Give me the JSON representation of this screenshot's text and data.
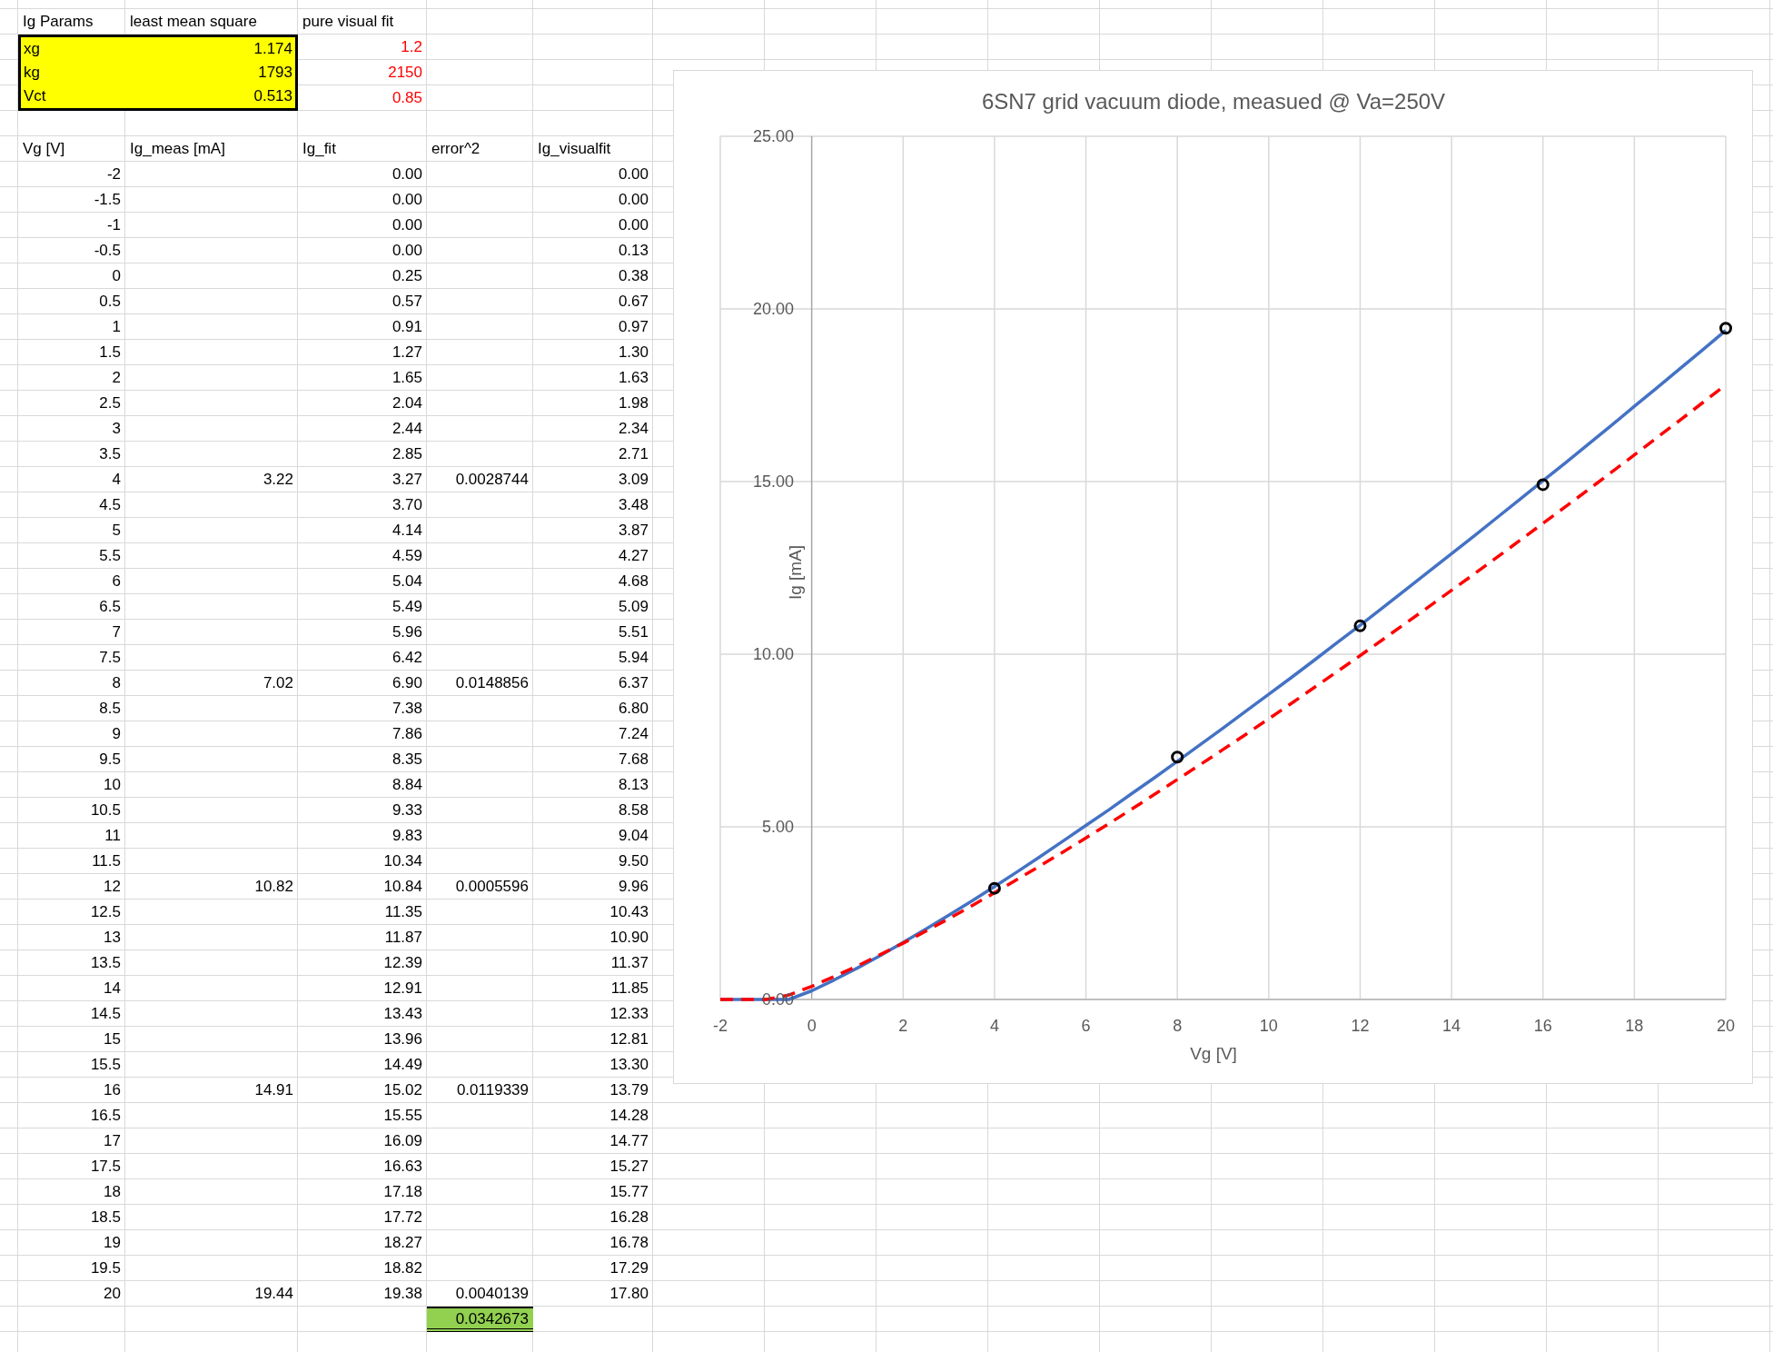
{
  "params": {
    "columns": [
      "Ig Params",
      "least mean square",
      "pure visual fit"
    ],
    "rows": [
      {
        "name": "xg",
        "least_mean_square": "1.174",
        "pure_visual_fit": "1.2"
      },
      {
        "name": "kg",
        "least_mean_square": "1793",
        "pure_visual_fit": "2150"
      },
      {
        "name": "Vct",
        "least_mean_square": "0.513",
        "pure_visual_fit": "0.85"
      }
    ]
  },
  "table": {
    "columns": [
      "Vg [V]",
      "Ig_meas [mA]",
      "Ig_fit",
      "error^2",
      "Ig_visualfit"
    ],
    "rows": [
      {
        "vg": "-2",
        "ig_fit": "0.00",
        "ig_visualfit": "0.00"
      },
      {
        "vg": "-1.5",
        "ig_fit": "0.00",
        "ig_visualfit": "0.00"
      },
      {
        "vg": "-1",
        "ig_fit": "0.00",
        "ig_visualfit": "0.00"
      },
      {
        "vg": "-0.5",
        "ig_fit": "0.00",
        "ig_visualfit": "0.13"
      },
      {
        "vg": "0",
        "ig_fit": "0.25",
        "ig_visualfit": "0.38"
      },
      {
        "vg": "0.5",
        "ig_fit": "0.57",
        "ig_visualfit": "0.67"
      },
      {
        "vg": "1",
        "ig_fit": "0.91",
        "ig_visualfit": "0.97"
      },
      {
        "vg": "1.5",
        "ig_fit": "1.27",
        "ig_visualfit": "1.30"
      },
      {
        "vg": "2",
        "ig_fit": "1.65",
        "ig_visualfit": "1.63"
      },
      {
        "vg": "2.5",
        "ig_fit": "2.04",
        "ig_visualfit": "1.98"
      },
      {
        "vg": "3",
        "ig_fit": "2.44",
        "ig_visualfit": "2.34"
      },
      {
        "vg": "3.5",
        "ig_fit": "2.85",
        "ig_visualfit": "2.71"
      },
      {
        "vg": "4",
        "ig_meas": "3.22",
        "ig_fit": "3.27",
        "error2": "0.0028744",
        "ig_visualfit": "3.09"
      },
      {
        "vg": "4.5",
        "ig_fit": "3.70",
        "ig_visualfit": "3.48"
      },
      {
        "vg": "5",
        "ig_fit": "4.14",
        "ig_visualfit": "3.87"
      },
      {
        "vg": "5.5",
        "ig_fit": "4.59",
        "ig_visualfit": "4.27"
      },
      {
        "vg": "6",
        "ig_fit": "5.04",
        "ig_visualfit": "4.68"
      },
      {
        "vg": "6.5",
        "ig_fit": "5.49",
        "ig_visualfit": "5.09"
      },
      {
        "vg": "7",
        "ig_fit": "5.96",
        "ig_visualfit": "5.51"
      },
      {
        "vg": "7.5",
        "ig_fit": "6.42",
        "ig_visualfit": "5.94"
      },
      {
        "vg": "8",
        "ig_meas": "7.02",
        "ig_fit": "6.90",
        "error2": "0.0148856",
        "ig_visualfit": "6.37"
      },
      {
        "vg": "8.5",
        "ig_fit": "7.38",
        "ig_visualfit": "6.80"
      },
      {
        "vg": "9",
        "ig_fit": "7.86",
        "ig_visualfit": "7.24"
      },
      {
        "vg": "9.5",
        "ig_fit": "8.35",
        "ig_visualfit": "7.68"
      },
      {
        "vg": "10",
        "ig_fit": "8.84",
        "ig_visualfit": "8.13"
      },
      {
        "vg": "10.5",
        "ig_fit": "9.33",
        "ig_visualfit": "8.58"
      },
      {
        "vg": "11",
        "ig_fit": "9.83",
        "ig_visualfit": "9.04"
      },
      {
        "vg": "11.5",
        "ig_fit": "10.34",
        "ig_visualfit": "9.50"
      },
      {
        "vg": "12",
        "ig_meas": "10.82",
        "ig_fit": "10.84",
        "error2": "0.0005596",
        "ig_visualfit": "9.96"
      },
      {
        "vg": "12.5",
        "ig_fit": "11.35",
        "ig_visualfit": "10.43"
      },
      {
        "vg": "13",
        "ig_fit": "11.87",
        "ig_visualfit": "10.90"
      },
      {
        "vg": "13.5",
        "ig_fit": "12.39",
        "ig_visualfit": "11.37"
      },
      {
        "vg": "14",
        "ig_fit": "12.91",
        "ig_visualfit": "11.85"
      },
      {
        "vg": "14.5",
        "ig_fit": "13.43",
        "ig_visualfit": "12.33"
      },
      {
        "vg": "15",
        "ig_fit": "13.96",
        "ig_visualfit": "12.81"
      },
      {
        "vg": "15.5",
        "ig_fit": "14.49",
        "ig_visualfit": "13.30"
      },
      {
        "vg": "16",
        "ig_meas": "14.91",
        "ig_fit": "15.02",
        "error2": "0.0119339",
        "ig_visualfit": "13.79"
      },
      {
        "vg": "16.5",
        "ig_fit": "15.55",
        "ig_visualfit": "14.28"
      },
      {
        "vg": "17",
        "ig_fit": "16.09",
        "ig_visualfit": "14.77"
      },
      {
        "vg": "17.5",
        "ig_fit": "16.63",
        "ig_visualfit": "15.27"
      },
      {
        "vg": "18",
        "ig_fit": "17.18",
        "ig_visualfit": "15.77"
      },
      {
        "vg": "18.5",
        "ig_fit": "17.72",
        "ig_visualfit": "16.28"
      },
      {
        "vg": "19",
        "ig_fit": "18.27",
        "ig_visualfit": "16.78"
      },
      {
        "vg": "19.5",
        "ig_fit": "18.82",
        "ig_visualfit": "17.29"
      },
      {
        "vg": "20",
        "ig_meas": "19.44",
        "ig_fit": "19.38",
        "error2": "0.0040139",
        "ig_visualfit": "17.80"
      }
    ],
    "error_sum": "0.0342673"
  },
  "chart_data": {
    "type": "line",
    "title": "6SN7 grid vacuum diode, measued @ Va=250V",
    "xlabel": "Vg [V]",
    "ylabel": "Ig [mA]",
    "x": [
      -2,
      -1.5,
      -1,
      -0.5,
      0,
      0.5,
      1,
      1.5,
      2,
      2.5,
      3,
      3.5,
      4,
      4.5,
      5,
      5.5,
      6,
      6.5,
      7,
      7.5,
      8,
      8.5,
      9,
      9.5,
      10,
      10.5,
      11,
      11.5,
      12,
      12.5,
      13,
      13.5,
      14,
      14.5,
      15,
      15.5,
      16,
      16.5,
      17,
      17.5,
      18,
      18.5,
      19,
      19.5,
      20
    ],
    "grid": true,
    "series": [
      {
        "line_style": "solid",
        "color": "#4472c4",
        "values": [
          0,
          0,
          0,
          0,
          0.25,
          0.57,
          0.91,
          1.27,
          1.65,
          2.04,
          2.44,
          2.85,
          3.27,
          3.7,
          4.14,
          4.59,
          5.04,
          5.49,
          5.96,
          6.42,
          6.9,
          7.38,
          7.86,
          8.35,
          8.84,
          9.33,
          9.83,
          10.34,
          10.84,
          11.35,
          11.87,
          12.39,
          12.91,
          13.43,
          13.96,
          14.49,
          15.02,
          15.55,
          16.09,
          16.63,
          17.18,
          17.72,
          18.27,
          18.82,
          19.38
        ]
      },
      {
        "line_style": "dashed",
        "color": "#ff0000",
        "values": [
          0,
          0,
          0,
          0.13,
          0.38,
          0.67,
          0.97,
          1.3,
          1.63,
          1.98,
          2.34,
          2.71,
          3.09,
          3.48,
          3.87,
          4.27,
          4.68,
          5.09,
          5.51,
          5.94,
          6.37,
          6.8,
          7.24,
          7.68,
          8.13,
          8.58,
          9.04,
          9.5,
          9.96,
          10.43,
          10.9,
          11.37,
          11.85,
          12.33,
          12.81,
          13.3,
          13.79,
          14.28,
          14.77,
          15.27,
          15.77,
          16.28,
          16.78,
          17.29,
          17.8
        ]
      },
      {
        "type": "scatter",
        "marker": "circle",
        "color": "#000000",
        "values": [
          null,
          null,
          null,
          null,
          null,
          null,
          null,
          null,
          null,
          null,
          null,
          null,
          3.22,
          null,
          null,
          null,
          null,
          null,
          null,
          null,
          7.02,
          null,
          null,
          null,
          null,
          null,
          null,
          null,
          10.82,
          null,
          null,
          null,
          null,
          null,
          null,
          null,
          14.91,
          null,
          null,
          null,
          null,
          null,
          null,
          null,
          19.44
        ]
      }
    ],
    "xlim": [
      -2,
      20
    ],
    "ylim": [
      0,
      25
    ],
    "xticks": [
      -2,
      0,
      2,
      4,
      6,
      8,
      10,
      12,
      14,
      16,
      18,
      20
    ],
    "yticks": [
      {
        "value": 0,
        "label": "0.00"
      },
      {
        "value": 5,
        "label": "5.00"
      },
      {
        "value": 10,
        "label": "10.00"
      },
      {
        "value": 15,
        "label": "15.00"
      },
      {
        "value": 20,
        "label": "20.00"
      },
      {
        "value": 25,
        "label": "25.00"
      }
    ]
  }
}
